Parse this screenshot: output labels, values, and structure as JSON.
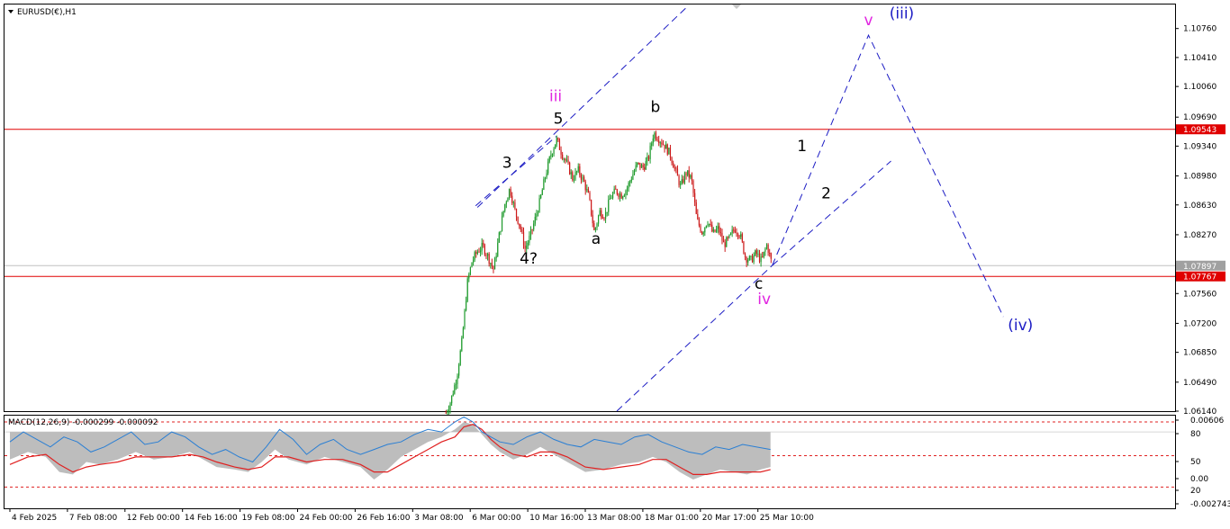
{
  "header": {
    "symbol_label": "EURUSD(€),H1",
    "macd_label": "MACD(12,26,9) -0.000299 -0.000092"
  },
  "colors": {
    "bull_candle": "#1e9a2c",
    "bear_candle": "#cc1a1a",
    "hline": "#e00000",
    "bid_line": "#c0c0c0",
    "trend_line": "#1c1cc4",
    "label_black": "#000000",
    "label_magenta": "#e024e0",
    "label_blue": "#1c1cc4",
    "macd_hist": "#bdbdbd",
    "macd_signal": "#e02020",
    "macd_line": "#2a7fd4",
    "level_dash": "#e02020"
  },
  "chart_data": [
    {
      "type": "candlestick",
      "title": "EURUSD(€),H1",
      "ylim": [
        1.0614,
        1.1105
      ],
      "xlim": [
        -6,
        1296
      ],
      "price_ticks": [
        "1.10760",
        "1.10410",
        "1.10060",
        "1.09690",
        "1.09340",
        "1.08980",
        "1.08630",
        "1.08270",
        "1.07560",
        "1.07200",
        "1.06850",
        "1.06490",
        "1.06140"
      ],
      "price_tags": [
        {
          "text": "1.09543",
          "bg": "#e00000"
        },
        {
          "text": "1.07897",
          "bg": "#a0a0a0"
        },
        {
          "text": "1.07767",
          "bg": "#e00000"
        }
      ],
      "time_labels": [
        {
          "text": "4 Feb 2025",
          "x": 0
        },
        {
          "text": "7 Feb 08:00",
          "x": 64
        },
        {
          "text": "12 Feb 00:00",
          "x": 128
        },
        {
          "text": "14 Feb 16:00",
          "x": 192
        },
        {
          "text": "19 Feb 08:00",
          "x": 256
        },
        {
          "text": "24 Feb 00:00",
          "x": 320
        },
        {
          "text": "26 Feb 16:00",
          "x": 384
        },
        {
          "text": "3 Mar 08:00",
          "x": 448
        },
        {
          "text": "6 Mar 00:00",
          "x": 512
        },
        {
          "text": "10 Mar 16:00",
          "x": 576
        },
        {
          "text": "13 Mar 08:00",
          "x": 640
        },
        {
          "text": "18 Mar 01:00",
          "x": 704
        },
        {
          "text": "20 Mar 17:00",
          "x": 768
        },
        {
          "text": "25 Mar 10:00",
          "x": 832
        }
      ],
      "horizontal_levels": [
        1.09543,
        1.07767
      ],
      "bid_level": 1.07897,
      "price_path": [
        [
          485,
          1.0612
        ],
        [
          490,
          1.0625
        ],
        [
          497,
          1.0655
        ],
        [
          503,
          1.07
        ],
        [
          509,
          1.077
        ],
        [
          514,
          1.0795
        ],
        [
          520,
          1.0807
        ],
        [
          526,
          1.0813
        ],
        [
          532,
          1.08
        ],
        [
          538,
          1.0785
        ],
        [
          544,
          1.0825
        ],
        [
          550,
          1.0862
        ],
        [
          556,
          1.0883
        ],
        [
          562,
          1.0855
        ],
        [
          568,
          1.0835
        ],
        [
          573,
          1.081
        ],
        [
          578,
          1.0823
        ],
        [
          584,
          1.0845
        ],
        [
          590,
          1.087
        ],
        [
          596,
          1.09
        ],
        [
          602,
          1.0925
        ],
        [
          608,
          1.0942
        ],
        [
          614,
          1.0925
        ],
        [
          620,
          1.0912
        ],
        [
          626,
          1.0895
        ],
        [
          632,
          1.0905
        ],
        [
          638,
          1.0892
        ],
        [
          644,
          1.0872
        ],
        [
          650,
          1.083
        ],
        [
          656,
          1.0855
        ],
        [
          662,
          1.085
        ],
        [
          668,
          1.0872
        ],
        [
          674,
          1.088
        ],
        [
          680,
          1.0875
        ],
        [
          686,
          1.0882
        ],
        [
          692,
          1.0898
        ],
        [
          698,
          1.0912
        ],
        [
          704,
          1.0908
        ],
        [
          710,
          1.0918
        ],
        [
          716,
          1.095
        ],
        [
          722,
          1.0943
        ],
        [
          728,
          1.0935
        ],
        [
          734,
          1.0925
        ],
        [
          740,
          1.0905
        ],
        [
          746,
          1.0885
        ],
        [
          752,
          1.0902
        ],
        [
          758,
          1.0895
        ],
        [
          764,
          1.0845
        ],
        [
          770,
          1.083
        ],
        [
          776,
          1.0845
        ],
        [
          782,
          1.0828
        ],
        [
          788,
          1.0835
        ],
        [
          794,
          1.0815
        ],
        [
          800,
          1.0822
        ],
        [
          806,
          1.0835
        ],
        [
          812,
          1.0828
        ],
        [
          818,
          1.08
        ],
        [
          824,
          1.0796
        ],
        [
          830,
          1.0805
        ],
        [
          836,
          1.0795
        ],
        [
          842,
          1.0815
        ],
        [
          848,
          1.079
        ]
      ],
      "trend_lines": [
        [
          [
            520,
            1.086
          ],
          [
            755,
            1.1104
          ]
        ],
        [
          [
            518,
            1.0862
          ],
          [
            608,
            1.0946
          ]
        ],
        [
          [
            675,
            1.0614
          ],
          [
            848,
            1.079
          ]
        ],
        [
          [
            848,
            1.079
          ],
          [
            980,
            1.0916
          ]
        ],
        [
          [
            848,
            1.079
          ],
          [
            955,
            1.1068
          ],
          [
            1105,
            1.0728
          ]
        ]
      ],
      "wave_labels": [
        {
          "text": "iii",
          "x": 607,
          "y": 1.0988,
          "color": "magenta"
        },
        {
          "text": "5",
          "x": 610,
          "y": 1.0961,
          "color": "black"
        },
        {
          "text": "3",
          "x": 553,
          "y": 1.0908,
          "color": "black"
        },
        {
          "text": "b",
          "x": 718,
          "y": 1.0975,
          "color": "black"
        },
        {
          "text": "a",
          "x": 652,
          "y": 1.0816,
          "color": "black"
        },
        {
          "text": "4?",
          "x": 577,
          "y": 1.0792,
          "color": "black"
        },
        {
          "text": "c",
          "x": 833,
          "y": 1.0762,
          "color": "black"
        },
        {
          "text": "iv",
          "x": 839,
          "y": 1.0743,
          "color": "magenta"
        },
        {
          "text": "1",
          "x": 881,
          "y": 1.0928,
          "color": "black"
        },
        {
          "text": "2",
          "x": 908,
          "y": 1.0871,
          "color": "black"
        },
        {
          "text": "v",
          "x": 955,
          "y": 1.108,
          "color": "magenta"
        },
        {
          "text": "(iii)",
          "x": 992,
          "y": 1.1088,
          "color": "blue"
        },
        {
          "text": "(iv)",
          "x": 1124,
          "y": 1.0712,
          "color": "blue"
        }
      ]
    },
    {
      "type": "area",
      "title": "MACD(12,26,9)",
      "ylim": [
        -0.00305,
        0.00065
      ],
      "y_ticks": [
        "0.00606",
        "80",
        "50",
        "0.00",
        "20",
        "-0.002743"
      ],
      "levels": [
        0.0004,
        -0.00095,
        -0.0022
      ],
      "series": [
        {
          "name": "MACD",
          "x": [
            0,
            20,
            40,
            55,
            70,
            85,
            100,
            120,
            140,
            160,
            180,
            200,
            215,
            230,
            250,
            265,
            280,
            295,
            310,
            330,
            350,
            370,
            390,
            405,
            420,
            435,
            450,
            465,
            480,
            495,
            505,
            515,
            525,
            535,
            545,
            560,
            575,
            590,
            605,
            620,
            640,
            660,
            680,
            700,
            715,
            730,
            745,
            760,
            775,
            790,
            805,
            820,
            835,
            846
          ],
          "values": [
            -0.0011,
            -0.0008,
            -0.001,
            -0.0016,
            -0.0017,
            -0.0012,
            -0.0013,
            -0.0011,
            -0.0008,
            -0.0011,
            -0.001,
            -0.0008,
            -0.0011,
            -0.0014,
            -0.0015,
            -0.0016,
            -0.0012,
            -0.0007,
            -0.0011,
            -0.0013,
            -0.001,
            -0.0012,
            -0.0014,
            -0.0019,
            -0.0015,
            -0.001,
            -0.0007,
            -0.0004,
            -0.0002,
            0.0001,
            0.0004,
            0.0003,
            -0.0001,
            -0.0005,
            -0.0008,
            -0.0011,
            -0.0009,
            -0.0006,
            -0.0009,
            -0.0012,
            -0.0016,
            -0.0015,
            -0.0013,
            -0.0012,
            -0.001,
            -0.0012,
            -0.0016,
            -0.0019,
            -0.0017,
            -0.0015,
            -0.0016,
            -0.0017,
            -0.0015,
            -0.0014
          ]
        },
        {
          "name": "Signal",
          "x": [
            0,
            20,
            40,
            55,
            70,
            85,
            100,
            120,
            140,
            160,
            180,
            200,
            215,
            230,
            250,
            265,
            280,
            295,
            310,
            330,
            350,
            370,
            390,
            405,
            420,
            435,
            450,
            465,
            480,
            495,
            505,
            515,
            525,
            535,
            545,
            560,
            575,
            590,
            605,
            620,
            640,
            660,
            680,
            700,
            715,
            730,
            745,
            760,
            775,
            790,
            805,
            820,
            835,
            846
          ],
          "values": [
            -0.0013,
            -0.001,
            -0.0009,
            -0.0013,
            -0.0016,
            -0.0014,
            -0.0013,
            -0.0012,
            -0.001,
            -0.001,
            -0.001,
            -0.0009,
            -0.001,
            -0.0012,
            -0.0014,
            -0.0015,
            -0.0014,
            -0.001,
            -0.001,
            -0.0012,
            -0.0011,
            -0.0011,
            -0.0013,
            -0.0016,
            -0.0016,
            -0.0013,
            -0.001,
            -0.0007,
            -0.0004,
            -0.0002,
            0.0002,
            0.0003,
            0.0001,
            -0.0003,
            -0.0006,
            -0.0009,
            -0.001,
            -0.0008,
            -0.0008,
            -0.001,
            -0.0014,
            -0.0015,
            -0.0014,
            -0.0013,
            -0.0011,
            -0.0011,
            -0.0014,
            -0.0017,
            -0.0017,
            -0.0016,
            -0.0016,
            -0.0016,
            -0.0016,
            -0.0015
          ]
        },
        {
          "name": "Oscillator",
          "x": [
            0,
            15,
            30,
            45,
            60,
            75,
            90,
            105,
            120,
            135,
            150,
            165,
            180,
            195,
            210,
            225,
            240,
            255,
            270,
            285,
            300,
            315,
            330,
            345,
            360,
            375,
            390,
            405,
            420,
            435,
            450,
            465,
            480,
            495,
            505,
            515,
            525,
            535,
            545,
            560,
            575,
            590,
            605,
            620,
            635,
            650,
            665,
            680,
            695,
            710,
            725,
            740,
            755,
            770,
            785,
            800,
            815,
            830,
            846
          ],
          "values": [
            -0.0004,
            0.0,
            -0.0003,
            -0.0006,
            -0.0002,
            -0.0004,
            -0.0008,
            -0.0006,
            -0.0003,
            0.0,
            -0.0005,
            -0.0004,
            0.0,
            -0.0002,
            -0.0006,
            -0.0009,
            -0.0007,
            -0.001,
            -0.0012,
            -0.0006,
            0.0001,
            -0.0003,
            -0.0009,
            -0.0005,
            -0.0003,
            -0.0007,
            -0.0009,
            -0.0007,
            -0.0005,
            -0.0004,
            -0.0001,
            0.0001,
            0.0,
            0.0004,
            0.0006,
            0.0004,
            0.0,
            -0.0002,
            -0.0004,
            -0.0005,
            -0.0002,
            0.0,
            -0.0003,
            -0.0005,
            -0.0006,
            -0.0003,
            -0.0004,
            -0.0005,
            -0.0002,
            -0.0001,
            -0.0004,
            -0.0006,
            -0.0008,
            -0.0009,
            -0.0006,
            -0.0007,
            -0.0005,
            -0.0006,
            -0.0007
          ]
        }
      ]
    }
  ]
}
